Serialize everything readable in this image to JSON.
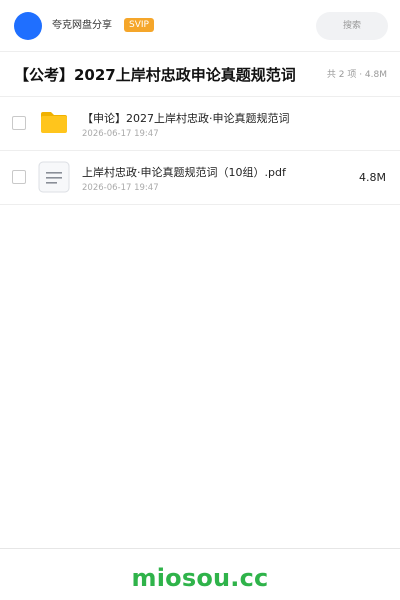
{
  "header": {
    "title": "夸克网盘分享",
    "badge": "SVIP",
    "search_placeholder": "搜索"
  },
  "folder": {
    "title": "【公考】2027上岸村忠政申论真题规范词",
    "summary": "共 2 项 · 4.8M"
  },
  "files": [
    {
      "name": "【申论】2027上岸村忠政·申论真题规范词",
      "date": "2026-06-17 19:47",
      "size": "",
      "icon": "folder-icon"
    },
    {
      "name": "上岸村忠政·申论真题规范词（10组）.pdf",
      "date": "2026-06-17 19:47",
      "size": "4.8M",
      "icon": "document-icon"
    }
  ],
  "footer": {
    "brand": "miosou.cc"
  },
  "colors": {
    "accent": "#1f6fff",
    "svip": "#f5a62a",
    "folder": "#ffc51c",
    "brand": "#2fb34a"
  }
}
